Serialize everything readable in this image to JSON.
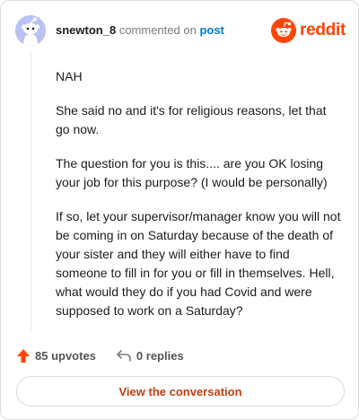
{
  "comment": {
    "author": "snewton_8",
    "action_text": "commented on",
    "post_link": "post",
    "paragraphs": [
      "NAH",
      "She said no and it's for religious reasons, let that go now.",
      "The question for you is this.... are you OK losing your job for this purpose? (I would be personally)",
      "If so, let your supervisor/manager know you will not be coming in on Saturday because of the death of your sister and they will either have to find someone to fill in for you or fill in themselves. Hell, what would they do if you had Covid and were supposed to work on a Saturday?"
    ],
    "upvotes": "85 upvotes",
    "replies": "0 replies"
  },
  "brand": {
    "name": "reddit",
    "accent": "#ff4500"
  },
  "actions": {
    "view_conversation": "View the conversation"
  },
  "icons": [
    "snoo-avatar-icon",
    "reddit-logo-icon",
    "upvote-arrow-icon",
    "reply-arrow-icon"
  ],
  "colors": {
    "upvote": "#ff4500",
    "link": "#0079d3",
    "button_text": "#c43d0b"
  }
}
